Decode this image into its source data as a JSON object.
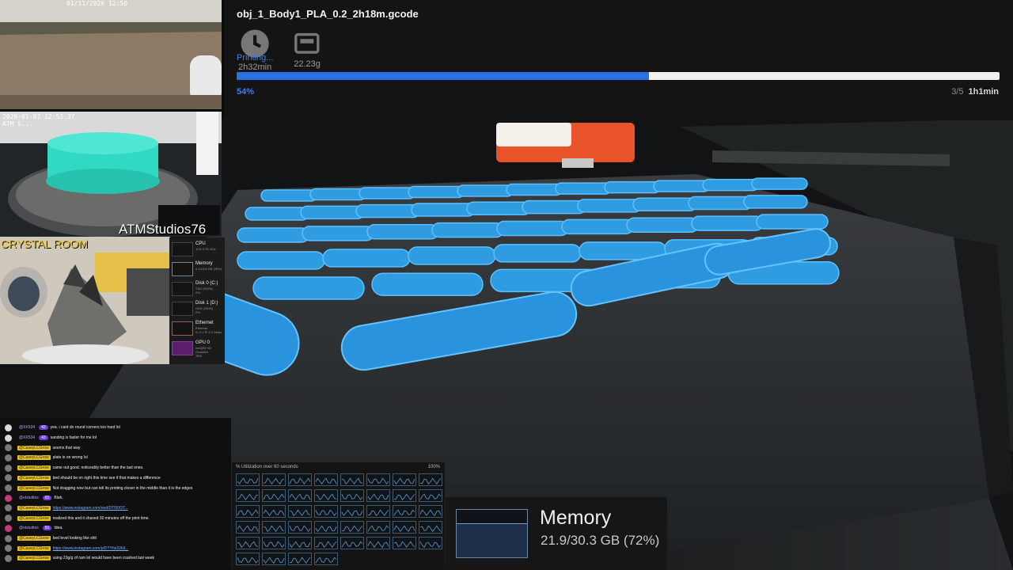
{
  "print": {
    "file_name": "obj_1_Body1_PLA_0.2_2h18m.gcode",
    "time_estimate": "2h32min",
    "filament_weight": "22.23g",
    "status": "Printing...",
    "progress_percent": 54,
    "progress_label": "54%",
    "layer": "3/5",
    "remaining": "1h1min",
    "colors": {
      "accent": "#2a6fe0",
      "track": "#f0f0f0",
      "panel": "#141414"
    },
    "icons": {
      "time": "clock-icon",
      "weight": "scale-icon"
    }
  },
  "overlays": {
    "yard_timestamp": "01/11/2026 12:50",
    "printer_cam_timestamp": "2026-01-07 12:53:37",
    "printer_cam_sub": "ATM S...",
    "brand": "ATMStudios76",
    "crystal_room": "CRYSTAL ROOM"
  },
  "task_manager": {
    "items": [
      {
        "title": "CPU",
        "sub": "11% 3.76 GHz"
      },
      {
        "title": "Memory",
        "sub": "4.1/15.8 GB (26%)"
      },
      {
        "title": "Disk 0 (C:)",
        "sub": "SSD (SATA)\n0%"
      },
      {
        "title": "Disk 1 (D:)",
        "sub": "HDD (SATA)\n0%"
      },
      {
        "title": "Ethernet",
        "sub": "Ethernet\nS: 3.1 R: 0.1 Mbps"
      },
      {
        "title": "GPU 0",
        "sub": "Intel(R) HD Graphics\n78%"
      }
    ]
  },
  "chat": {
    "messages": [
      {
        "user": "@XX534",
        "badge": "43",
        "text": "yea. i cant do round corners too hard lol",
        "avatar_color": "#d8d8d8",
        "user_style": "alt"
      },
      {
        "user": "@XX534",
        "badge": "43",
        "text": "sanding is faster for me lol",
        "avatar_color": "#d8d8d8",
        "user_style": "alt"
      },
      {
        "user": "@CaseyLCGrow",
        "badge": "",
        "text": "seems that way",
        "avatar_color": "#7a7a7a",
        "user_style": "highlight"
      },
      {
        "user": "@CaseyLCGrow",
        "badge": "",
        "text": "plate is on wrong lol",
        "avatar_color": "#7a7a7a",
        "user_style": "highlight"
      },
      {
        "user": "@CaseyLCGrow",
        "badge": "",
        "text": "came out good. noticeably better than the last ones.",
        "avatar_color": "#7a7a7a",
        "user_style": "highlight"
      },
      {
        "user": "@CaseyLCGrow",
        "badge": "",
        "text": "bed should be on right this time see if that makes a difference",
        "avatar_color": "#7a7a7a",
        "user_style": "highlight"
      },
      {
        "user": "@CaseyLCGrow",
        "badge": "",
        "text": "Not dragging now but can tell its printing closer in the middle than it is the edges",
        "avatar_color": "#7a7a7a",
        "user_style": "highlight"
      },
      {
        "user": "@olstudios",
        "badge": "81",
        "text": "Blah.",
        "avatar_color": "#c23a7a",
        "user_style": "alt"
      },
      {
        "user": "@CaseyLCGrow",
        "badge": "",
        "text": "https://www.instagram.com/reel/DTI50OT...",
        "avatar_color": "#7a7a7a",
        "user_style": "highlight",
        "link": true
      },
      {
        "user": "@CaseyLCGrow",
        "badge": "",
        "text": "realized this and it shaved 30 minutes off the print time.",
        "avatar_color": "#7a7a7a",
        "user_style": "highlight"
      },
      {
        "user": "@olstudios",
        "badge": "81",
        "text": "Idea.",
        "avatar_color": "#c23a7a",
        "user_style": "alt"
      },
      {
        "user": "@CaseyLCGrow",
        "badge": "",
        "text": "bed level looking like shit",
        "avatar_color": "#7a7a7a",
        "user_style": "highlight"
      },
      {
        "user": "@CaseyLCGrow",
        "badge": "",
        "text": "https://www.instagram.com/p/DTYhn22k9...",
        "avatar_color": "#7a7a7a",
        "user_style": "highlight",
        "link": true
      },
      {
        "user": "@CaseyLCGrow",
        "badge": "",
        "text": "using 23g/g of ram lol would have been crashed last week",
        "avatar_color": "#7a7a7a",
        "user_style": "highlight"
      }
    ]
  },
  "cpu_panel": {
    "header": "% Utilization over 60 seconds",
    "max_label": "100%",
    "color": "#3d5a73"
  },
  "memory": {
    "title": "Memory",
    "value": "21.9/30.3 GB (72%)",
    "usage_fraction": 0.72,
    "color": "#1e2f4a"
  }
}
